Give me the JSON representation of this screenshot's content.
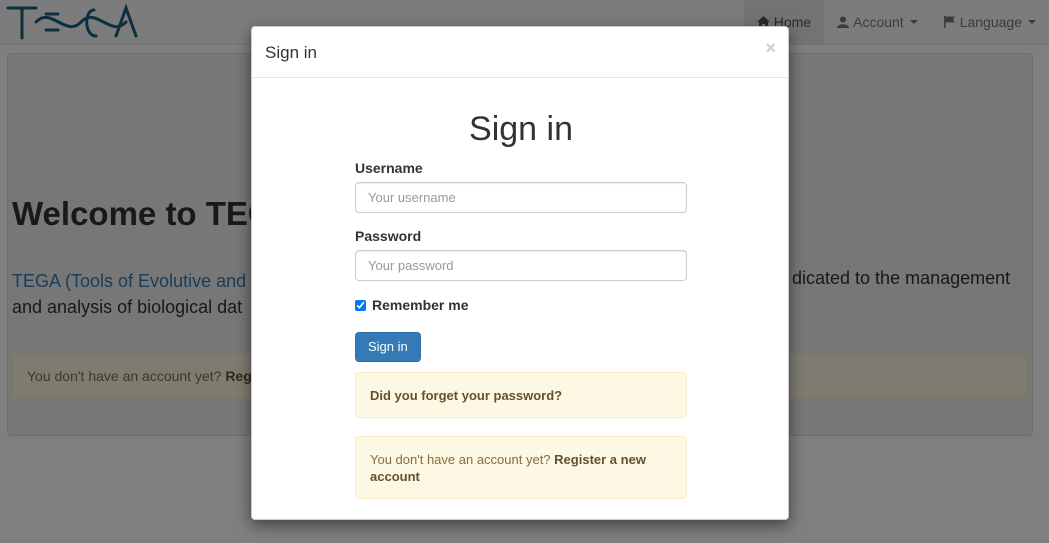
{
  "navbar": {
    "brand": "TEGA",
    "items": [
      {
        "label": "Home",
        "icon": "home-icon",
        "active": true
      },
      {
        "label": "Account",
        "icon": "user-icon",
        "dropdown": true
      },
      {
        "label": "Language",
        "icon": "flag-icon",
        "dropdown": true
      }
    ]
  },
  "page": {
    "welcome_title": "Welcome to TEG",
    "intro_link": "TEGA (Tools of Evolutive and",
    "intro_tail": "dicated to the management",
    "intro_line2": "and analysis of biological dat",
    "alert_text": "You don't have an account yet?",
    "alert_link": "Registe"
  },
  "modal": {
    "header_title": "Sign in",
    "close_symbol": "×",
    "form_title": "Sign in",
    "username_label": "Username",
    "username_placeholder": "Your username",
    "password_label": "Password",
    "password_placeholder": "Your password",
    "remember_label": "Remember me",
    "remember_checked": true,
    "submit_label": "Sign in",
    "forgot_text": "Did you forget your password?",
    "register_text": "You don't have an account yet?",
    "register_link": "Register a new account"
  },
  "colors": {
    "primary": "#337ab7",
    "warning_bg": "#fcf8e3",
    "warning_text": "#8a6d3b",
    "logo": "#1a5e7a"
  }
}
